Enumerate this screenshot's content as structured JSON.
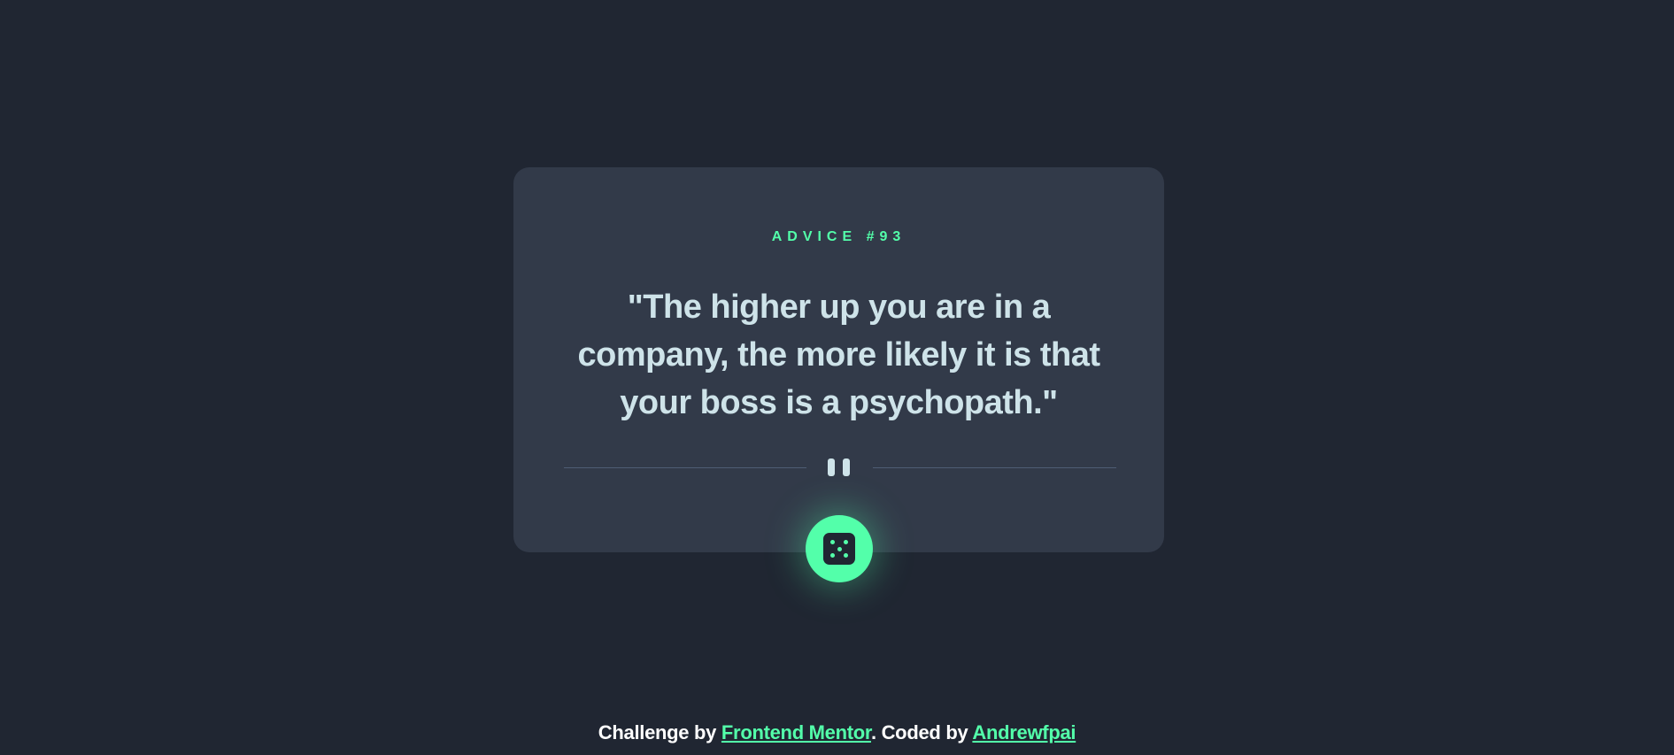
{
  "card": {
    "label": "ADVICE #93",
    "quote": "\"The higher up you are in a company, the more likely it is that your boss is a psychopath.\"",
    "divider_icon": "pause-icon"
  },
  "dice_button": {
    "icon": "dice-icon"
  },
  "footer": {
    "challenge_text": "Challenge by ",
    "challenge_link": "Frontend Mentor",
    "coded_text": ". Coded by ",
    "author_link": "Andrewfpai"
  },
  "colors": {
    "background": "#202632",
    "card": "#323a49",
    "accent": "#53ffaa",
    "text": "#cee3e9",
    "divider": "#4f5d74"
  }
}
